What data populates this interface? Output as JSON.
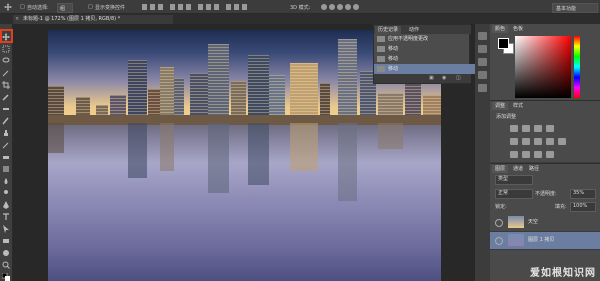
{
  "optbar": {
    "auto_select_label": "自动选择:",
    "auto_select_value": "组",
    "show_transform_label": "显示变换控件",
    "mode_3d_label": "3D 模式:",
    "workspace_label": "基本功能"
  },
  "document": {
    "tab_title": "未标题-1 @ 172% (图层 1 拷贝, RGB/8) *"
  },
  "history_panel": {
    "tabs": [
      "历史记录",
      "动作"
    ],
    "rows": [
      {
        "label": "应用不透明度更改"
      },
      {
        "label": "移动"
      },
      {
        "label": "移动"
      },
      {
        "label": "移动"
      }
    ]
  },
  "color_panel": {
    "tabs": [
      "颜色",
      "色板"
    ]
  },
  "adjustments_panel": {
    "tabs": [
      "调整",
      "样式"
    ],
    "title": "添加调整"
  },
  "layers_panel": {
    "tabs": [
      "图层",
      "通道",
      "路径"
    ],
    "kind_label": "类型",
    "blend_mode": "正常",
    "opacity_label": "不透明度:",
    "opacity_value": "35%",
    "lock_label": "锁定:",
    "fill_label": "填充:",
    "fill_value": "100%",
    "layers": [
      {
        "name": "天空"
      },
      {
        "name": "图层 1 拷贝"
      }
    ]
  },
  "watermark": "爱如根知识网",
  "colors": {
    "accent_highlight": "#e0401b",
    "selected_row": "#6b7ea1"
  }
}
